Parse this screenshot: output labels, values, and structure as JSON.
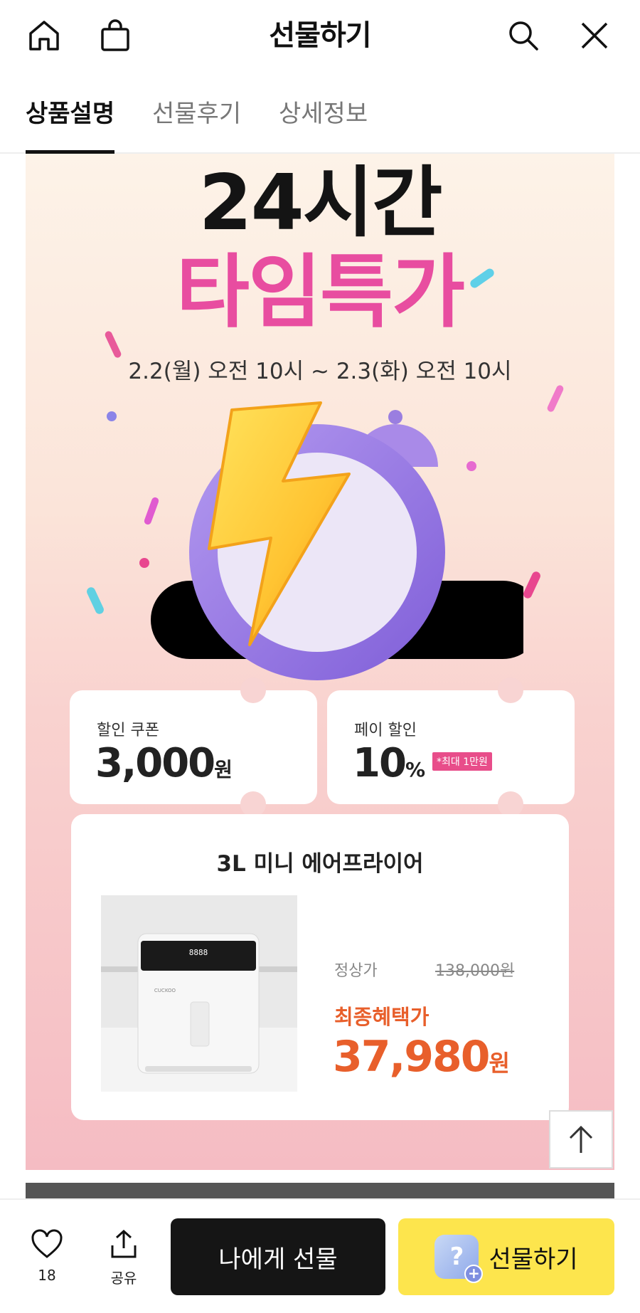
{
  "header": {
    "title": "선물하기",
    "icons": [
      "home-icon",
      "shopping-bag-icon",
      "search-icon",
      "close-icon"
    ]
  },
  "tabs": [
    {
      "label": "상품설명",
      "active": true
    },
    {
      "label": "선물후기",
      "active": false
    },
    {
      "label": "상세정보",
      "active": false
    }
  ],
  "banner": {
    "headline_top": "24시간",
    "headline_main": "타임특가",
    "period": "2.2(월) 오전 10시 ~ 2.3(화) 오전 10시",
    "accent_color": "#e84da0"
  },
  "coupons": [
    {
      "label": "할인 쿠폰",
      "value": "3,000",
      "unit": "원"
    },
    {
      "label": "페이 할인",
      "value": "10",
      "unit": "%",
      "badge": "*최대 1만원"
    }
  ],
  "product": {
    "name": "3L 미니 에어프라이어",
    "original_label": "정상가",
    "original_price": "138,000원",
    "final_label": "최종혜택가",
    "final_price": "37,980",
    "final_unit": "원",
    "photo_brand": "CUCKOO",
    "photo_display": "8888",
    "price_color": "#e85f2b"
  },
  "bottom_bar": {
    "like_count": "18",
    "share_label": "공유",
    "gift_self_label": "나에게 선물",
    "gift_label": "선물하기"
  }
}
